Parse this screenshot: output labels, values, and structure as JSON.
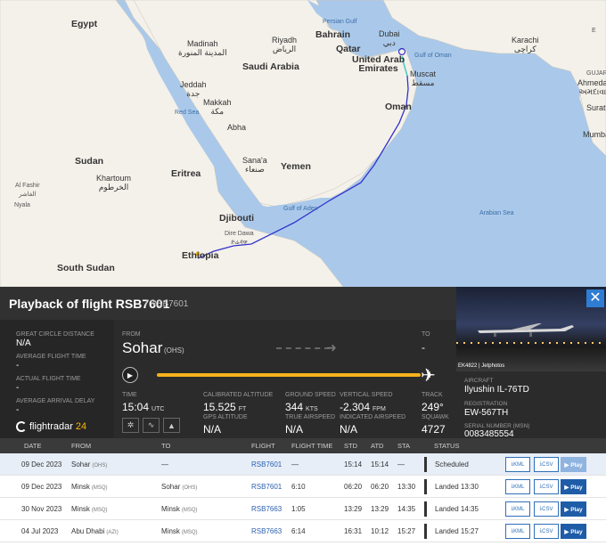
{
  "map": {
    "labels": {
      "egypt": "Egypt",
      "madinah": "Madinah\nالمدينة المنورة",
      "riyadh": "Riyadh\nالرياض",
      "saudi": "Saudi Arabia",
      "bahrain": "Bahrain",
      "qatar": "Qatar",
      "dubai": "Dubai\nدبي",
      "uae": "United Arab\nEmirates",
      "gulf_oman": "Gulf of Oman",
      "muscat": "Muscat\nمسقط",
      "persian_gulf": "Persian Gulf",
      "karachi": "Karachi\nكراچی",
      "gujarat": "GUJARAT",
      "ahmedabad": "Ahmedab\nઅમદાવાદ",
      "surat": "Surat",
      "mumbai": "Mumbai",
      "jeddah": "Jeddah\nجدة",
      "makkah": "Makkah\nمكة",
      "red_sea": "Red Sea",
      "abha": "Abha",
      "oman": "Oman",
      "sudan": "Sudan",
      "khartoum": "Khartoum\nالخرطوم",
      "eritrea": "Eritrea",
      "sanaa": "Sana'a\nصنعاء",
      "yemen": "Yemen",
      "al_fashir": "Al Fashir\nالفاشر",
      "nyala": "Nyala",
      "gulf_aden": "Gulf of Aden",
      "djibouti": "Djibouti",
      "dire_dawa": "Dire Dawa\nድሬዳዋ",
      "arabian_sea": "Arabian Sea",
      "ethiopia": "Ethiopia",
      "south_sudan": "South Sudan",
      "corner": "E"
    }
  },
  "header": {
    "title": "Playback of flight RSB7601",
    "subtitle": "/ RSB7601"
  },
  "left": {
    "gcd_label": "GREAT CIRCLE DISTANCE",
    "gcd_value": "N/A",
    "aft_label": "AVERAGE FLIGHT TIME",
    "aft_value": "-",
    "act_label": "ACTUAL FLIGHT TIME",
    "act_value": "-",
    "aad_label": "AVERAGE ARRIVAL DELAY",
    "aad_value": "-",
    "logo_text": "flightradar",
    "logo_num": "24"
  },
  "flight": {
    "from_label": "FROM",
    "from_city": "Sohar",
    "from_code": "(OHS)",
    "to_label": "TO",
    "to_value": "-",
    "progress": 1.0
  },
  "stats": {
    "time_label": "TIME",
    "time_value": "15:04",
    "time_unit": "UTC",
    "cal_alt_label": "CALIBRATED ALTITUDE",
    "cal_alt_value": "15.525",
    "cal_alt_unit": "FT",
    "gs_label": "GROUND SPEED",
    "gs_value": "344",
    "gs_unit": "KTS",
    "vs_label": "VERTICAL SPEED",
    "vs_value": "-2.304",
    "vs_unit": "FPM",
    "track_label": "TRACK",
    "track_value": "249°",
    "gps_label": "GPS ALTITUDE",
    "gps_value": "N/A",
    "tas_label": "TRUE AIRSPEED",
    "tas_value": "N/A",
    "ias_label": "INDICATED AIRSPEED",
    "ias_value": "N/A",
    "squawk_label": "SQUAWK",
    "squawk_value": "4727"
  },
  "aircraft": {
    "photo_credit": "EK4822 | Jetphotos",
    "aircraft_label": "AIRCRAFT",
    "aircraft_value": "Ilyushin IL-76TD",
    "reg_label": "REGISTRATION",
    "reg_value": "EW-567TH",
    "msn_label": "SERIAL NUMBER (MSN)",
    "msn_value": "0083485554",
    "close": "✕"
  },
  "table": {
    "headers": [
      "DATE",
      "FROM",
      "TO",
      "FLIGHT",
      "FLIGHT TIME",
      "STD",
      "ATD",
      "STA",
      "STATUS"
    ],
    "rows": [
      {
        "date": "09 Dec 2023",
        "from": "Sohar",
        "from_code": "(OHS)",
        "to": "—",
        "to_code": "",
        "flight": "RSB7601",
        "ftime": "—",
        "std": "15:14",
        "atd": "15:14",
        "sta": "—",
        "status": "Scheduled"
      },
      {
        "date": "09 Dec 2023",
        "from": "Minsk",
        "from_code": "(MSQ)",
        "to": "Sohar",
        "to_code": "(OHS)",
        "flight": "RSB7601",
        "ftime": "6:10",
        "std": "06:20",
        "atd": "06:20",
        "sta": "13:30",
        "status": "Landed 13:30"
      },
      {
        "date": "30 Nov 2023",
        "from": "Minsk",
        "from_code": "(MSQ)",
        "to": "Minsk",
        "to_code": "(MSQ)",
        "flight": "RSB7663",
        "ftime": "1:05",
        "std": "13:29",
        "atd": "13:29",
        "sta": "14:35",
        "status": "Landed 14:35"
      },
      {
        "date": "04 Jul 2023",
        "from": "Abu Dhabi",
        "from_code": "(AZI)",
        "to": "Minsk",
        "to_code": "(MSQ)",
        "flight": "RSB7663",
        "ftime": "6:14",
        "std": "16:31",
        "atd": "10:12",
        "sta": "15:27",
        "status": "Landed 15:27"
      }
    ],
    "kml": "KML",
    "csv": "CSV",
    "play": "▶ Play"
  },
  "colors": {
    "track": "#3333cc",
    "track_end": "#4fd1c5",
    "progress": "#f6b21b",
    "accent": "#1e5ca8"
  }
}
